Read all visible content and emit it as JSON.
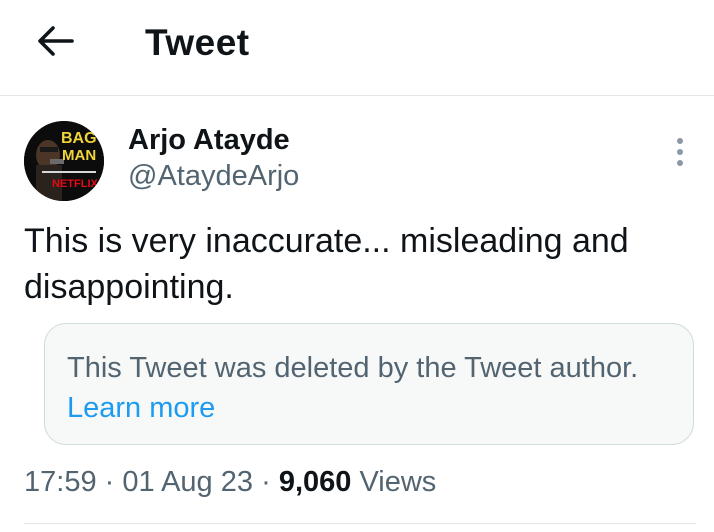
{
  "header": {
    "title": "Tweet",
    "back_icon": "arrow-left-icon"
  },
  "author": {
    "name": "Arjo Atayde",
    "handle": "@AtaydeArjo",
    "avatar": {
      "poster_title_line1": "BAG",
      "poster_title_line2": "MAN",
      "poster_brand": "NETFLIX"
    },
    "more_icon": "more-vertical-icon"
  },
  "tweet": {
    "text": "This is very inaccurate... misleading and disappointing."
  },
  "quoted": {
    "message": "This Tweet was deleted by the Tweet author.",
    "link": "Learn more"
  },
  "meta": {
    "time": "17:59",
    "separator": "·",
    "date": "01 Aug 23",
    "views_count": "9,060",
    "views_label": "Views"
  },
  "colors": {
    "text": "#0f1419",
    "muted": "#536471",
    "link": "#1d9bf0",
    "border": "#cfd9de",
    "quote_bg": "#f7f9f9"
  }
}
